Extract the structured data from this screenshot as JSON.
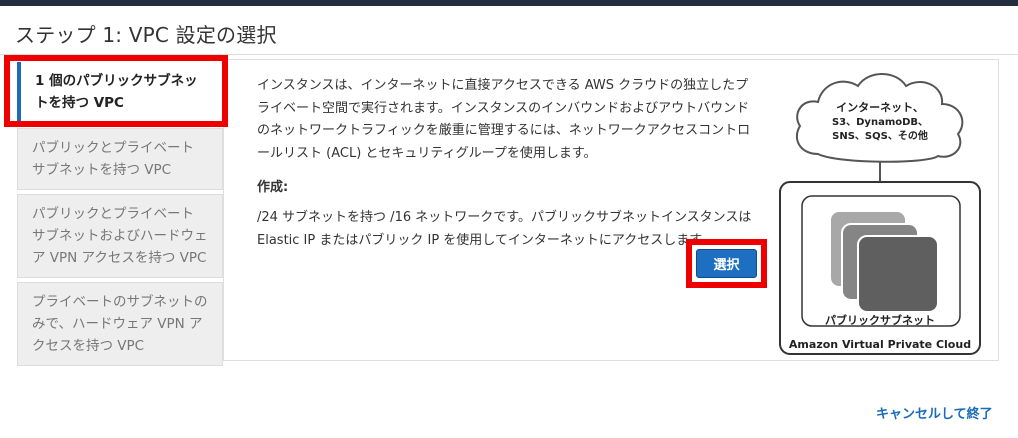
{
  "page": {
    "title": "ステップ 1: VPC 設定の選択"
  },
  "tabs": [
    {
      "label": "1 個のパブリックサブネットを持つ VPC",
      "active": true
    },
    {
      "label": "パブリックとプライベート サブネットを持つ VPC",
      "active": false
    },
    {
      "label": "パブリックとプライベート サブネットおよびハードウェア VPN アクセスを持つ VPC",
      "active": false
    },
    {
      "label": "プライベートのサブネットのみで、ハードウェア VPN アクセスを持つ VPC",
      "active": false
    }
  ],
  "content": {
    "description": "インスタンスは、インターネットに直接アクセスできる AWS クラウドの独立したプライベート空間で実行されます。インスタンスのインバウンドおよびアウトバウンドのネットワークトラフィックを厳重に管理するには、ネットワークアクセスコントロールリスト (ACL) とセキュリティグループを使用します。",
    "create_heading": "作成:",
    "create_body": "/24 サブネットを持つ /16 ネットワークです。パブリックサブネットインスタンスは Elastic IP またはパブリック IP を使用してインターネットにアクセスします。",
    "select_button": "選択"
  },
  "diagram": {
    "cloud_line1": "インターネット、",
    "cloud_line2": "S3、DynamoDB、",
    "cloud_line3": "SNS、SQS、その他",
    "subnet_label": "パブリックサブネット",
    "vpc_label": "Amazon Virtual Private Cloud"
  },
  "footer": {
    "cancel_link": "キャンセルして終了"
  },
  "colors": {
    "accent": "#1a6bb8",
    "button": "#1e6fc1",
    "highlight": "#ee0000",
    "topbar": "#232f3e"
  }
}
